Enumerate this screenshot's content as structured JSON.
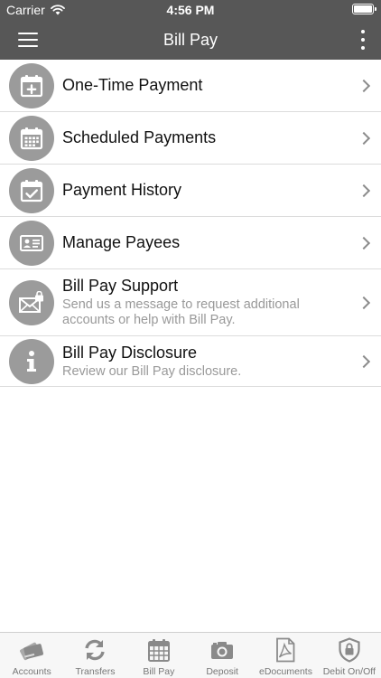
{
  "status_bar": {
    "carrier": "Carrier",
    "time": "4:56 PM"
  },
  "nav": {
    "title": "Bill Pay",
    "menu_icon": "hamburger-icon",
    "more_icon": "vertical-ellipsis-icon"
  },
  "items": [
    {
      "label": "One-Time Payment",
      "sub": "",
      "icon": "calendar-plus-icon"
    },
    {
      "label": "Scheduled Payments",
      "sub": "",
      "icon": "calendar-grid-icon"
    },
    {
      "label": "Payment History",
      "sub": "",
      "icon": "calendar-check-icon"
    },
    {
      "label": "Manage Payees",
      "sub": "",
      "icon": "id-card-icon"
    },
    {
      "label": "Bill Pay Support",
      "sub": "Send us a message to request additional accounts or help with Bill Pay.",
      "icon": "secure-envelope-icon"
    },
    {
      "label": "Bill Pay Disclosure",
      "sub": "Review our Bill Pay disclosure.",
      "icon": "info-icon"
    }
  ],
  "tabs": [
    {
      "label": "Accounts",
      "icon": "cards-icon"
    },
    {
      "label": "Transfers",
      "icon": "refresh-icon"
    },
    {
      "label": "Bill Pay",
      "icon": "calendar-icon"
    },
    {
      "label": "Deposit",
      "icon": "camera-icon"
    },
    {
      "label": "eDocuments",
      "icon": "pdf-document-icon"
    },
    {
      "label": "Debit On/Off",
      "icon": "shield-lock-icon"
    }
  ],
  "colors": {
    "header": "#575757",
    "icon_circle": "#9b9b9b",
    "subtext": "#999999"
  }
}
